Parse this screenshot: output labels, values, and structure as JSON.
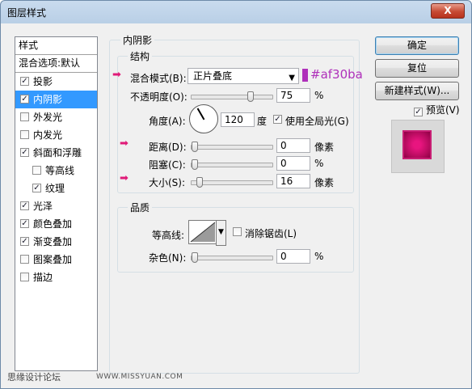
{
  "window": {
    "title": "图层样式",
    "close_label": "X"
  },
  "styles_list": {
    "header": "样式",
    "blend_options": "混合选项:默认",
    "items": [
      {
        "label": "投影",
        "checked": true,
        "indent": false,
        "selected": false
      },
      {
        "label": "内阴影",
        "checked": true,
        "indent": false,
        "selected": true
      },
      {
        "label": "外发光",
        "checked": false,
        "indent": false,
        "selected": false
      },
      {
        "label": "内发光",
        "checked": false,
        "indent": false,
        "selected": false
      },
      {
        "label": "斜面和浮雕",
        "checked": true,
        "indent": false,
        "selected": false
      },
      {
        "label": "等高线",
        "checked": false,
        "indent": true,
        "selected": false
      },
      {
        "label": "纹理",
        "checked": true,
        "indent": true,
        "selected": false
      },
      {
        "label": "光泽",
        "checked": true,
        "indent": false,
        "selected": false
      },
      {
        "label": "颜色叠加",
        "checked": true,
        "indent": false,
        "selected": false
      },
      {
        "label": "渐变叠加",
        "checked": true,
        "indent": false,
        "selected": false
      },
      {
        "label": "图案叠加",
        "checked": false,
        "indent": false,
        "selected": false
      },
      {
        "label": "描边",
        "checked": false,
        "indent": false,
        "selected": false
      }
    ]
  },
  "buttons": {
    "ok": "确定",
    "reset": "复位",
    "new_style": "新建样式(W)...",
    "preview": "预览(V)"
  },
  "preview_checked": true,
  "inner_shadow": {
    "group_title": "内阴影",
    "structure_title": "结构",
    "blend_mode_label": "混合模式(B):",
    "blend_mode_value": "正片叠底",
    "color": "#af30ba",
    "color_note": "#af30ba",
    "opacity_label": "不透明度(O):",
    "opacity_value": "75",
    "opacity_unit": "%",
    "opacity_level": 0.75,
    "angle_label": "角度(A):",
    "angle_value": "120",
    "angle_unit": "度",
    "global_light_label": "使用全局光(G)",
    "global_light_checked": true,
    "distance_label": "距离(D):",
    "distance_value": "0",
    "distance_unit": "像素",
    "distance_level": 0,
    "choke_label": "阻塞(C):",
    "choke_value": "0",
    "choke_unit": "%",
    "choke_level": 0,
    "size_label": "大小(S):",
    "size_value": "16",
    "size_unit": "像素",
    "size_level": 0.064
  },
  "quality": {
    "group_title": "品质",
    "contour_label": "等高线:",
    "antialias_label": "消除锯齿(L)",
    "antialias_checked": false,
    "noise_label": "杂色(N):",
    "noise_value": "0",
    "noise_unit": "%",
    "noise_level": 0
  },
  "watermark": {
    "left": "思缘设计论坛",
    "right": "WWW.MISSYUAN.COM"
  },
  "colors": {
    "selection": "#3399ff",
    "accent_arrow": "#e01a78",
    "swatch": "#af30ba"
  }
}
